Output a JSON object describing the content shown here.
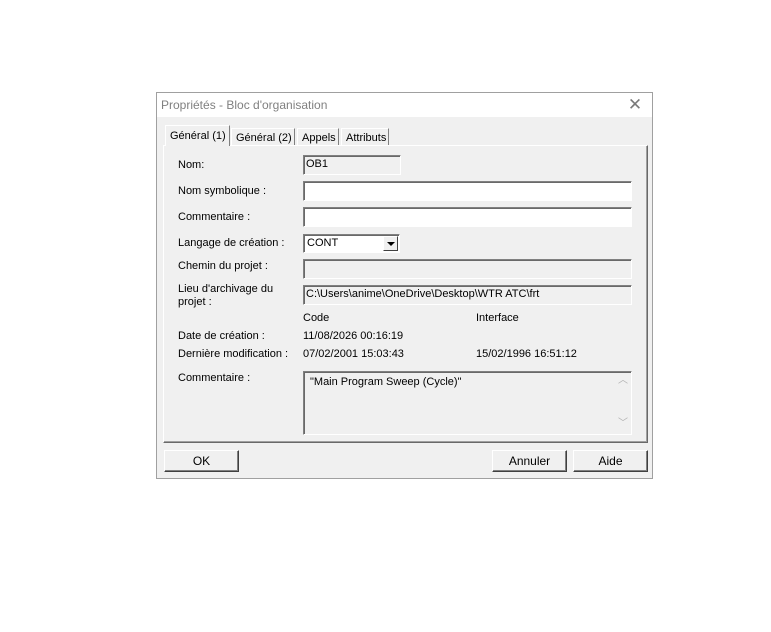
{
  "window": {
    "title": "Propriétés - Bloc d'organisation",
    "close_glyph": "✕"
  },
  "tabs": [
    {
      "label": "Général (1)",
      "active": true
    },
    {
      "label": "Général  (2)",
      "active": false
    },
    {
      "label": "Appels",
      "active": false
    },
    {
      "label": "Attributs",
      "active": false
    }
  ],
  "form": {
    "nom_label": "Nom:",
    "nom_value": "OB1",
    "nom_symbolique_label": "Nom symbolique :",
    "nom_symbolique_value": "",
    "commentaire_label": "Commentaire :",
    "commentaire_value": "",
    "langage_label": "Langage de création :",
    "langage_value": "CONT",
    "chemin_label": "Chemin du projet :",
    "chemin_value": "",
    "lieu_label_line1": "Lieu  d'archivage du",
    "lieu_label_line2": "projet :",
    "lieu_value": "C:\\Users\\anime\\OneDrive\\Desktop\\WTR ATC\\frt",
    "code_header": "Code",
    "interface_header": "Interface",
    "date_creation_label": "Date de création :",
    "date_creation_code": "11/08/2026 00:16:19",
    "derniere_modif_label": "Dernière modification :",
    "derniere_modif_code": "07/02/2001 15:03:43",
    "derniere_modif_interface": "15/02/1996 16:51:12",
    "commentaire2_label": "Commentaire :",
    "commentaire2_value": "\"Main Program Sweep (Cycle)\""
  },
  "buttons": {
    "ok": "OK",
    "annuler": "Annuler",
    "aide": "Aide"
  }
}
